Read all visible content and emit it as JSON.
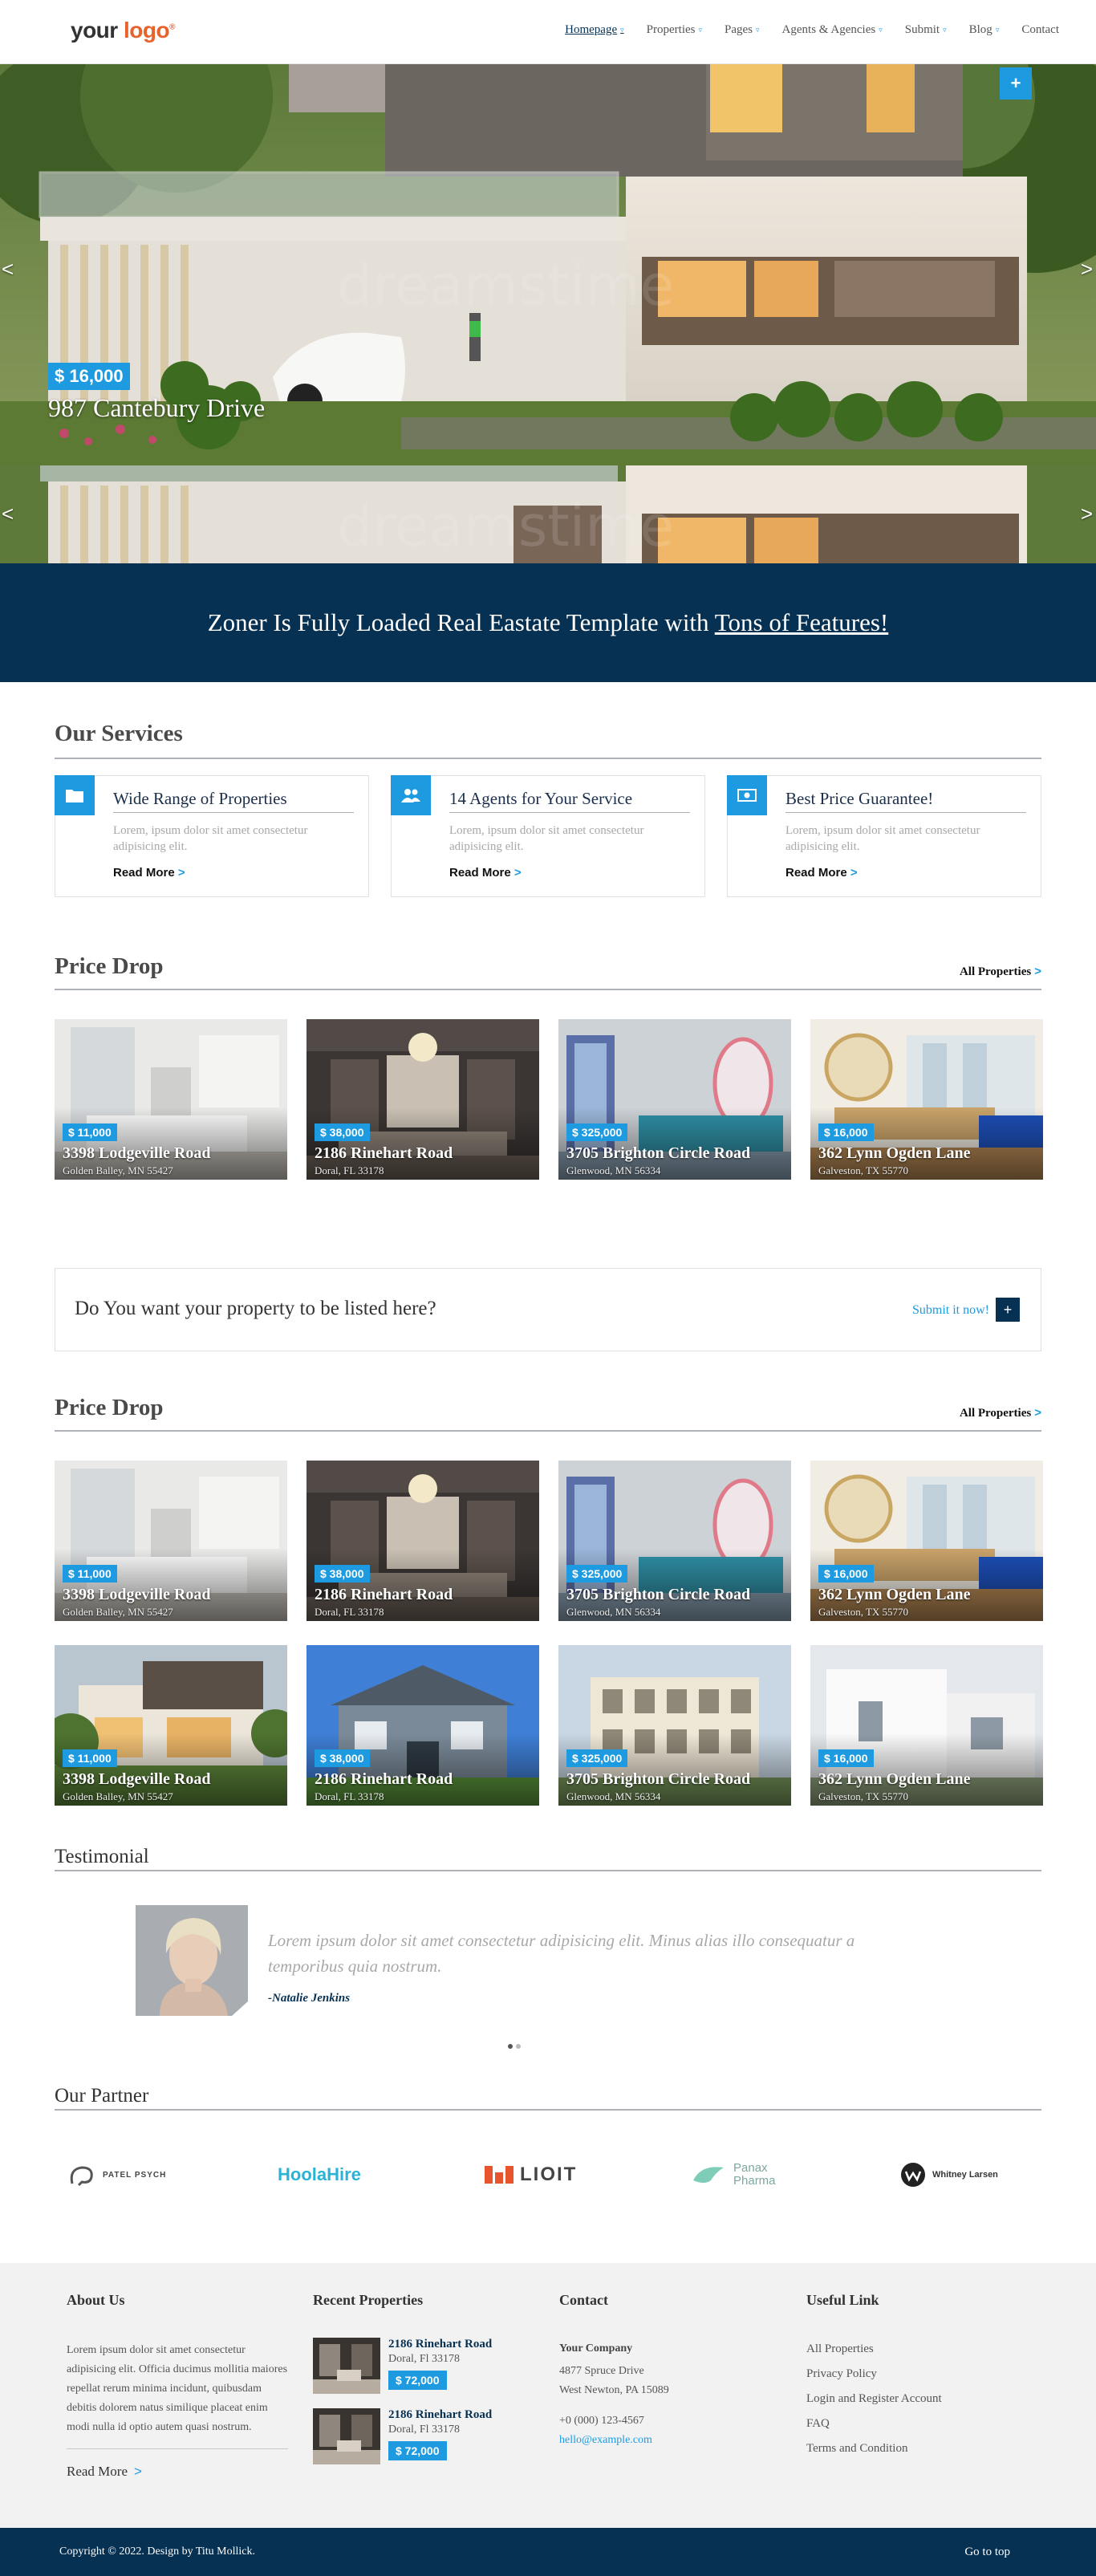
{
  "header": {
    "logo": {
      "main": "your ",
      "accent": "logo",
      "mark": "®"
    },
    "nav": [
      {
        "label": "Homepage",
        "dropdown": true,
        "active": true
      },
      {
        "label": "Properties",
        "dropdown": true
      },
      {
        "label": "Pages",
        "dropdown": true
      },
      {
        "label": "Agents & Agencies",
        "dropdown": true
      },
      {
        "label": "Submit",
        "dropdown": true
      },
      {
        "label": "Blog",
        "dropdown": true
      },
      {
        "label": "Contact",
        "dropdown": false
      }
    ],
    "caret": "▿"
  },
  "hero": {
    "price": "$ 16,000",
    "address": "987 Cantebury Drive",
    "plus": "+",
    "prev": "<",
    "next": ">"
  },
  "banner": {
    "text": "Zoner Is Fully Loaded Real Eastate Template with ",
    "link": "Tons of Features!"
  },
  "services": {
    "title": "Our Services",
    "items": [
      {
        "title": "Wide Range of Properties",
        "desc": "Lorem, ipsum dolor sit amet consectetur adipisicing elit.",
        "more": "Read More",
        "icon": "folder-icon"
      },
      {
        "title": "14 Agents for Your Service",
        "desc": "Lorem, ipsum dolor sit amet consectetur adipisicing elit.",
        "more": "Read More",
        "icon": "users-icon"
      },
      {
        "title": "Best Price Guarantee!",
        "desc": "Lorem, ipsum dolor sit amet consectetur adipisicing elit.",
        "more": "Read More",
        "icon": "money-icon"
      }
    ],
    "gt": ">"
  },
  "price_drop_1": {
    "title": "Price Drop",
    "all": "All Properties",
    "gt": ">",
    "cards": [
      {
        "price": "$ 11,000",
        "name": "3398 Lodgeville Road",
        "loc": "Golden Balley, MN 55427"
      },
      {
        "price": "$ 38,000",
        "name": "2186 Rinehart Road",
        "loc": "Doral, FL 33178"
      },
      {
        "price": "$ 325,000",
        "name": "3705 Brighton Circle Road",
        "loc": "Glenwood, MN 56334"
      },
      {
        "price": "$ 16,000",
        "name": "362 Lynn Ogden Lane",
        "loc": "Galveston, TX 55770"
      }
    ]
  },
  "cta": {
    "question": "Do You want your property to be listed here?",
    "submit": "Submit it now!",
    "plus": "+"
  },
  "price_drop_2": {
    "title": "Price Drop",
    "all": "All Properties",
    "gt": ">",
    "cards": [
      {
        "price": "$ 11,000",
        "name": "3398 Lodgeville Road",
        "loc": "Golden Balley, MN 55427"
      },
      {
        "price": "$ 38,000",
        "name": "2186 Rinehart Road",
        "loc": "Doral, FL 33178"
      },
      {
        "price": "$ 325,000",
        "name": "3705 Brighton Circle Road",
        "loc": "Glenwood, MN 56334"
      },
      {
        "price": "$ 16,000",
        "name": "362 Lynn Ogden Lane",
        "loc": "Galveston, TX 55770"
      },
      {
        "price": "$ 11,000",
        "name": "3398 Lodgeville Road",
        "loc": "Golden Balley, MN 55427"
      },
      {
        "price": "$ 38,000",
        "name": "2186 Rinehart Road",
        "loc": "Doral, FL 33178"
      },
      {
        "price": "$ 325,000",
        "name": "3705 Brighton Circle Road",
        "loc": "Glenwood, MN 56334"
      },
      {
        "price": "$ 16,000",
        "name": "362 Lynn Ogden Lane",
        "loc": "Galveston, TX 55770"
      }
    ]
  },
  "testimonial": {
    "title": "Testimonial",
    "quote": "Lorem ipsum dolor sit amet consectetur adipisicing elit. Minus alias illo consequatur a temporibus quia nostrum.",
    "author": "-Natalie Jenkins"
  },
  "partners": {
    "title": "Our Partner",
    "items": [
      "PATEL PSYCH",
      "HoolaHire",
      "LIOIT",
      "Panax Pharma",
      "Whitney Larsen"
    ]
  },
  "footer": {
    "about": {
      "title": "About Us",
      "text": "Lorem ipsum dolor sit amet consectetur adipisicing elit. Officia ducimus mollitia maiores repellat rerum minima incidunt, quibusdam debitis dolorem natus similique placeat enim modi nulla id optio autem quasi nostrum.",
      "more": "Read More",
      "gt": ">"
    },
    "recent": {
      "title": "Recent Properties",
      "items": [
        {
          "name": "2186 Rinehart Road",
          "loc": "Doral, Fl 33178",
          "price": "$ 72,000"
        },
        {
          "name": "2186 Rinehart Road",
          "loc": "Doral, Fl 33178",
          "price": "$ 72,000"
        }
      ]
    },
    "contact": {
      "title": "Contact",
      "company": "Your Company",
      "address1": "4877 Spruce Drive",
      "address2": "West Newton, PA 15089",
      "phone": "+0 (000) 123-4567",
      "email": "hello@example.com"
    },
    "links": {
      "title": "Useful Link",
      "items": [
        "All Properties",
        "Privacy Policy",
        "Login and Register Account",
        "FAQ",
        "Terms and Condition"
      ]
    },
    "copyright": "Copyright © 2022. Design by Titu Mollick.",
    "top": "Go to top"
  },
  "colors": {
    "primary": "#1e9be0",
    "navy": "#073152"
  }
}
